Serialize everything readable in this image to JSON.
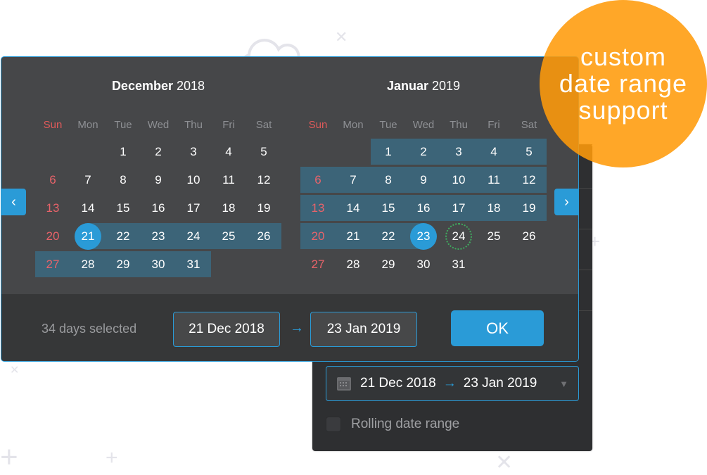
{
  "badge": {
    "lines": [
      "custom",
      "date range",
      "support"
    ],
    "color": "#ffa11f"
  },
  "calendar": {
    "nav_prev": "‹",
    "nav_next": "›",
    "weekdays": [
      "Sun",
      "Mon",
      "Tue",
      "Wed",
      "Thu",
      "Fri",
      "Sat"
    ],
    "months": [
      {
        "name": "December",
        "year": "2018",
        "weeks": [
          [
            "",
            "",
            "1",
            "2",
            "3",
            "4",
            "5"
          ],
          [
            "6",
            "7",
            "8",
            "9",
            "10",
            "11",
            "12"
          ],
          [
            "13",
            "14",
            "15",
            "16",
            "17",
            "18",
            "19"
          ],
          [
            "20",
            "21",
            "22",
            "23",
            "24",
            "25",
            "26"
          ],
          [
            "27",
            "28",
            "29",
            "30",
            "31",
            "",
            ""
          ]
        ]
      },
      {
        "name": "Januar",
        "year": "2019",
        "weeks": [
          [
            "",
            "",
            "1",
            "2",
            "3",
            "4",
            "5"
          ],
          [
            "6",
            "7",
            "8",
            "9",
            "10",
            "11",
            "12"
          ],
          [
            "13",
            "14",
            "15",
            "16",
            "17",
            "18",
            "19"
          ],
          [
            "20",
            "21",
            "22",
            "23",
            "24",
            "25",
            "26"
          ],
          [
            "27",
            "28",
            "29",
            "30",
            "31",
            "",
            ""
          ]
        ]
      }
    ],
    "range_start": "21 Dec 2018",
    "range_end": "23 Jan 2019",
    "today": "24 Jan 2019",
    "colors": {
      "accent": "#2a9bd7",
      "range": "#3c6478",
      "sunday": "#e9636a",
      "today_ring": "#3fae5f"
    }
  },
  "footer": {
    "days_selected": "34 days selected",
    "start_date": "21 Dec 2018",
    "end_date": "23 Jan 2019",
    "arrow": "→",
    "ok_label": "OK"
  },
  "back_panel": {
    "range_select": {
      "start": "21 Dec 2018",
      "arrow": "→",
      "end": "23 Jan 2019",
      "caret": "▼"
    },
    "rolling_label": "Rolling date range",
    "rolling_checked": false
  }
}
